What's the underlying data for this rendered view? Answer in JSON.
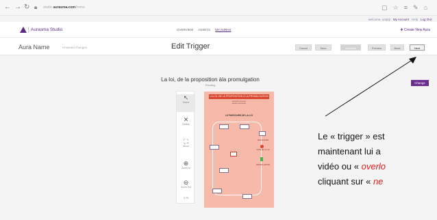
{
  "browser": {
    "back_icon": "back-arrow-icon",
    "url_prefix": "studio.",
    "url_host": "aurasma.com",
    "url_path": "/home",
    "welcome": "welcome, ustptp",
    "account": "My Account",
    "help": "Help",
    "logout": "Log Out"
  },
  "header": {
    "brand": "Aurasma Studio",
    "nav": [
      "OVERVIEW",
      "ASSETS",
      "MY AURAS"
    ],
    "create_label": "Create New Aura"
  },
  "edit_bar": {
    "aura_name": "Aura Name",
    "unsaved": "Unsaved changes",
    "title": "Edit Trigger",
    "buttons": [
      "Cancel",
      "Save",
      "Overlays",
      "Preview",
      "Back",
      "Next"
    ]
  },
  "workspace": {
    "trigger_title": "La loi, de la proposition àla promulgation",
    "trigger_status": "Pending",
    "change_label": "Change",
    "tools": [
      {
        "icon": "cursor-icon",
        "label": "Select"
      },
      {
        "icon": "x-icon",
        "label": "Delete"
      },
      {
        "icon": "resize-icon",
        "label": "Move"
      },
      {
        "icon": "zoom-in-icon",
        "label": "Zoom In"
      },
      {
        "icon": "zoom-out-icon",
        "label": "Zoom Out"
      },
      {
        "icon": "fit-icon",
        "label": "Fit"
      }
    ],
    "poster_heading": "LA LOI, DE LA PROPOSITION À LA PROMULGATION",
    "poster_title": "LE PARCOURS DE LA LOI",
    "poster_labels": [
      "APPLICATION",
      "VOTE DE LA LOI",
      "PROMULGATION"
    ]
  },
  "annotation": {
    "line1": "Le « trigger » est",
    "line2": "maintenant lui a",
    "line3_a": "vidéo ou « ",
    "line3_b": "overlo",
    "line4_a": "cliquant sur « ",
    "line4_b": "ne"
  },
  "colors": {
    "brand": "#5a2a82",
    "change": "#6a2d8f",
    "poster_bg": "#f7b9a9",
    "poster_head": "#d9432b",
    "annotation_red": "#e0201c"
  }
}
